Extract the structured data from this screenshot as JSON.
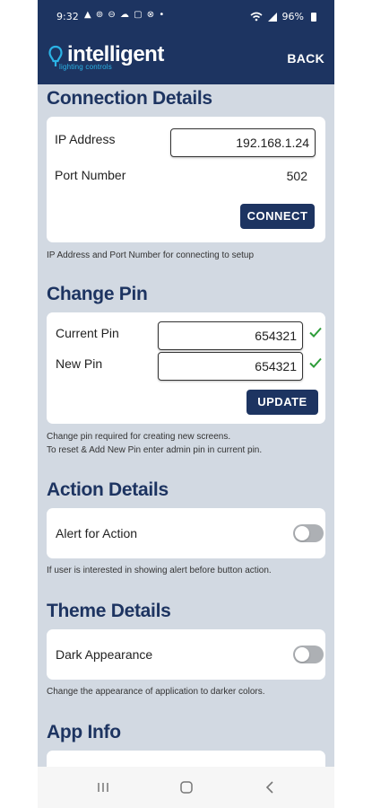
{
  "status_bar": {
    "time": "9:32",
    "notification_icons": "▲ ⊚ ⊖ ☁ ▢ ⊗ •",
    "battery": "96%"
  },
  "app_bar": {
    "logo_text": "intelligent",
    "logo_subtext": "lighting controls",
    "back_label": "BACK"
  },
  "connection": {
    "title": "Connection Details",
    "ip_label": "IP Address",
    "ip_value": "192.168.1.24",
    "port_label": "Port Number",
    "port_value": "502",
    "connect_label": "CONNECT",
    "note": "IP Address and Port Number for connecting to setup"
  },
  "change_pin": {
    "title": "Change Pin",
    "current_label": "Current Pin",
    "current_value": "654321",
    "new_label": "New Pin",
    "new_value": "654321",
    "update_label": "UPDATE",
    "note_line1": "Change pin required for creating new screens.",
    "note_line2": "To reset & Add New Pin enter admin pin in current pin."
  },
  "action": {
    "title": "Action Details",
    "toggle_label": "Alert for Action",
    "toggle_on": false,
    "note": "If user is interested in showing alert before button action."
  },
  "theme": {
    "title": "Theme Details",
    "toggle_label": "Dark Appearance",
    "toggle_on": false,
    "note": "Change the appearance of application to darker colors."
  },
  "app_info": {
    "title": "App Info"
  },
  "colors": {
    "primary": "#1d3461",
    "background": "#d2d9e2",
    "accent_logo": "#2bb3e6",
    "check": "#2e9d3a"
  },
  "nav_bar": {
    "recents_icon": "recents-icon",
    "home_icon": "home-icon",
    "back_icon": "back-arrow-icon"
  }
}
